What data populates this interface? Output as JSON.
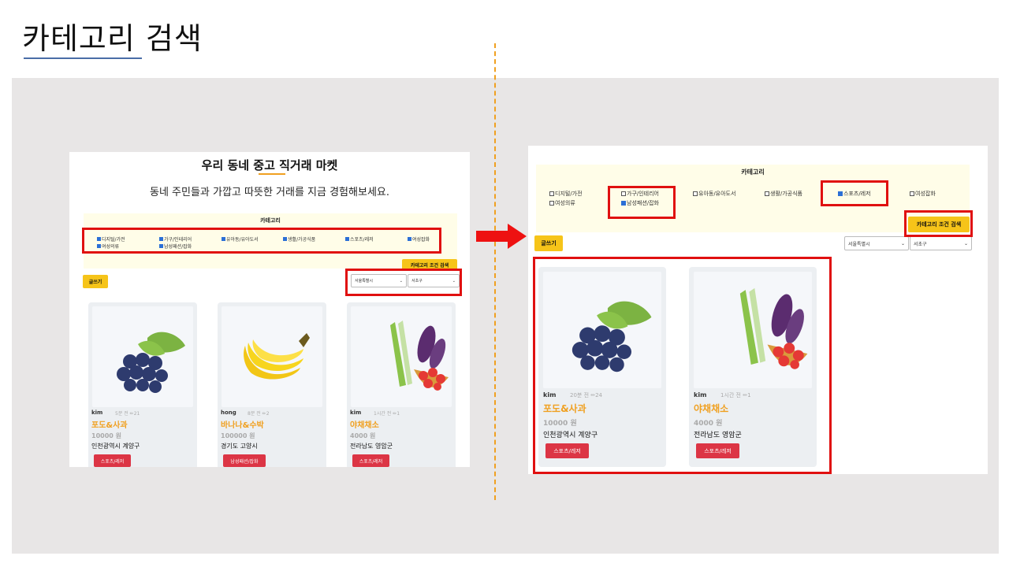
{
  "slide": {
    "title": "카테고리 검색"
  },
  "left": {
    "hero_title": "우리 동네 중고 직거래 마켓",
    "hero_subtitle": "동네 주민들과 가깝고 따뜻한 거래를 지금 경험해보세요.",
    "category_heading": "카테고리",
    "categories": [
      {
        "label": "디지털/가전",
        "checked": true
      },
      {
        "label": "가구/인테리어",
        "checked": true
      },
      {
        "label": "유아동/유아도서",
        "checked": true
      },
      {
        "label": "생활/가공식품",
        "checked": true
      },
      {
        "label": "스포츠/레저",
        "checked": true
      },
      {
        "label": "여성잡화",
        "checked": true
      },
      {
        "label": "여성의류",
        "checked": true
      },
      {
        "label": "남성패션/잡화",
        "checked": true
      }
    ],
    "search_button": "카테고리 조건 검색",
    "write_button": "글쓰기",
    "city_select": "서울특별시",
    "district_select": "서초구",
    "products": [
      {
        "user": "kim",
        "meta": "5분 전 ✏21",
        "title": "포도&사과",
        "price": "10000 원",
        "location": "인천광역시 계양구",
        "tag": "스포츠/레저",
        "image": "grapes-icon"
      },
      {
        "user": "hong",
        "meta": "8분 전 ✏2",
        "title": "바나나&수박",
        "price": "100000 원",
        "location": "경기도 고양시",
        "tag": "남성패션/잡화",
        "image": "banana-icon"
      },
      {
        "user": "kim",
        "meta": "1시간 전 ✏1",
        "title": "야채채소",
        "price": "4000 원",
        "location": "전라남도 영암군",
        "tag": "스포츠/레저",
        "image": "vegetables-icon"
      }
    ]
  },
  "right": {
    "category_heading": "카테고리",
    "categories": [
      {
        "label": "디지털/가전",
        "checked": false
      },
      {
        "label": "가구/인테리어",
        "checked": false
      },
      {
        "label": "유아동/유아도서",
        "checked": false
      },
      {
        "label": "생활/가공식품",
        "checked": false
      },
      {
        "label": "스포츠/레저",
        "checked": true
      },
      {
        "label": "여성잡화",
        "checked": false
      },
      {
        "label": "여성의류",
        "checked": false
      },
      {
        "label": "남성패션/잡화",
        "checked": true
      }
    ],
    "search_button": "카테고리 조건 검색",
    "write_button": "글쓰기",
    "city_select": "서울특별시",
    "district_select": "서초구",
    "products": [
      {
        "user": "kim",
        "meta": "20분 전 ✏24",
        "title": "포도&사과",
        "price": "10000 원",
        "location": "인천광역시 계양구",
        "tag": "스포츠/레저",
        "image": "grapes-icon"
      },
      {
        "user": "kim",
        "meta": "1시간 전 ✏1",
        "title": "야채채소",
        "price": "4000 원",
        "location": "전라남도 영암군",
        "tag": "스포츠/레저",
        "image": "vegetables-icon"
      }
    ]
  },
  "colors": {
    "accent": "#f0a020",
    "highlight": "#e01010",
    "tag": "#dc3545",
    "button": "#f6c419"
  }
}
